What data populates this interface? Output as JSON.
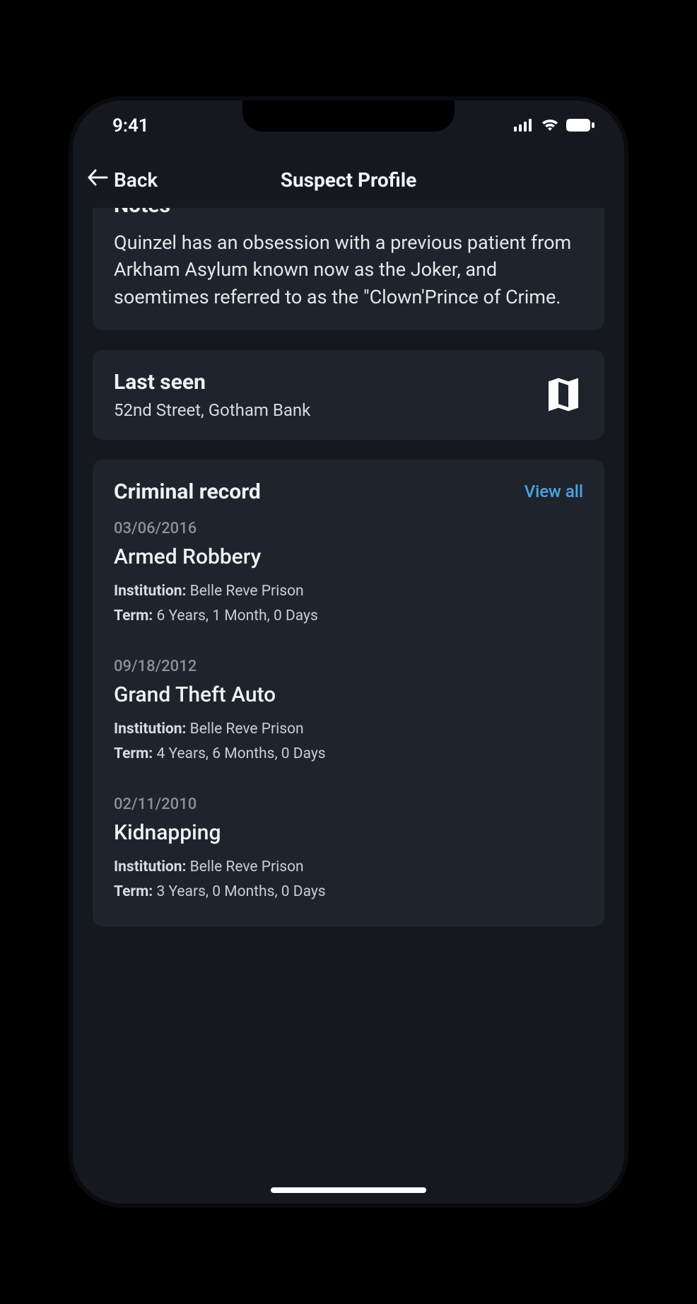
{
  "statusbar": {
    "time": "9:41"
  },
  "nav": {
    "back_label": "Back",
    "title": "Suspect Profile"
  },
  "notes": {
    "title": "Notes",
    "body": "Quinzel has an obsession with a previous patient from Arkham Asylum known now as the Joker, and soemtimes referred to as the \"Clown'Prince of Crime."
  },
  "last_seen": {
    "title": "Last seen",
    "location": "52nd Street, Gotham Bank"
  },
  "criminal_record": {
    "title": "Criminal record",
    "view_all_label": "View all",
    "institution_label": "Institution:",
    "term_label": "Term:",
    "items": [
      {
        "date": "03/06/2016",
        "crime": "Armed Robbery",
        "institution": "Belle Reve Prison",
        "term": "6 Years, 1 Month, 0 Days"
      },
      {
        "date": "09/18/2012",
        "crime": "Grand Theft Auto",
        "institution": "Belle Reve Prison",
        "term": "4 Years, 6 Months, 0 Days"
      },
      {
        "date": "02/11/2010",
        "crime": "Kidnapping",
        "institution": "Belle Reve Prison",
        "term": "3 Years, 0 Months, 0 Days"
      }
    ]
  }
}
